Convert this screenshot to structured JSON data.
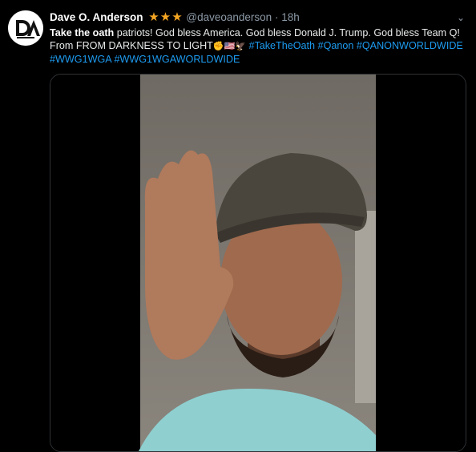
{
  "tweet": {
    "display_name": "Dave O. Anderson",
    "stars": "★★★",
    "handle": "@daveoanderson",
    "separator": "·",
    "time": "18h",
    "more_icon": "chevron-down-icon",
    "text_bold": "Take the oath",
    "text_1": " patriots! God bless America. God bless Donald J. Trump. God bless Team Q! From FROM DARKNESS TO LIGHT",
    "emojis": "✊🇺🇸🦅",
    "hashtags_1": "#TakeTheOath #Qanon #QANONWORLDWIDE",
    "hashtags_2": "#WWG1WGA #WWG1WGAWORLDWIDE"
  },
  "colors": {
    "background": "#000000",
    "link": "#1d9bf0",
    "star": "#f5a623",
    "muted": "#8b98a5"
  }
}
